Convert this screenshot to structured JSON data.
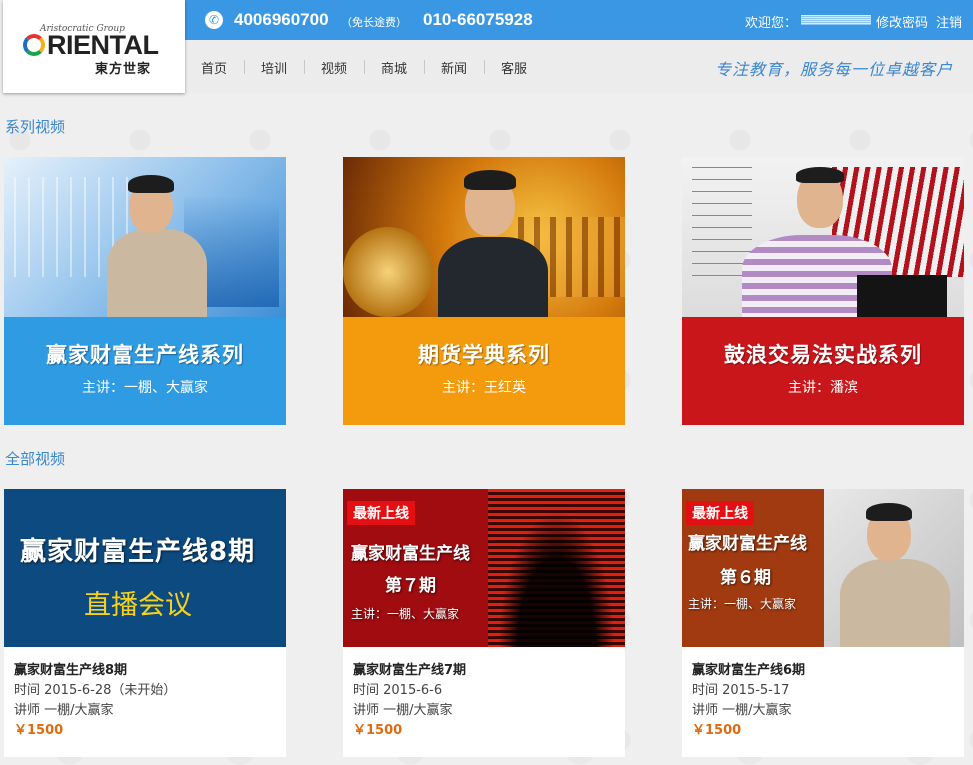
{
  "header": {
    "logo_top": "Aristocratic Group",
    "logo_main": "RIENTAL",
    "logo_cn": "東方世家",
    "phone_icon": "phone-icon",
    "phone_primary": "4006960700",
    "phone_primary_note": "（免长途费）",
    "phone_secondary": "010-66075928",
    "welcome": "欢迎您：",
    "change_password": "修改密码",
    "logout": "注销"
  },
  "nav": {
    "items": [
      "首页",
      "培训",
      "视频",
      "商城",
      "新闻",
      "客服"
    ],
    "slogan": "专注教育，服务每一位卓越客户"
  },
  "series_section": {
    "title": "系列视频",
    "cards": [
      {
        "title": "赢家财富生产线系列",
        "subtitle": "主讲：一棚、大赢家",
        "color": "#2f9be3"
      },
      {
        "title": "期货学典系列",
        "subtitle": "主讲：王红英",
        "color": "#f39a0d"
      },
      {
        "title": "鼓浪交易法实战系列",
        "subtitle": "主讲：潘滨",
        "color": "#c9161b"
      }
    ]
  },
  "all_section": {
    "title": "全部视频",
    "cards": [
      {
        "thumb_line1": "赢家财富生产线8期",
        "thumb_line2": "直播会议",
        "title": "赢家财富生产线8期",
        "time": "时间 2015-6-28（未开始）",
        "teacher": "讲师 一棚/大赢家",
        "price": "￥1500"
      },
      {
        "badge": "最新上线",
        "thumb_line1": "赢家财富生产线",
        "thumb_line2": "第７期",
        "thumb_line3": "主讲：一棚、大赢家",
        "title": "赢家财富生产线7期",
        "time": "时间 2015-6-6",
        "teacher": "讲师 一棚/大赢家",
        "price": "￥1500"
      },
      {
        "badge": "最新上线",
        "thumb_line1": "赢家财富生产线",
        "thumb_line2": "第６期",
        "thumb_line3": "主讲：一棚、大赢家",
        "title": "赢家财富生产线6期",
        "time": "时间 2015-5-17",
        "teacher": "讲师 一棚/大赢家",
        "price": "￥1500"
      }
    ]
  }
}
